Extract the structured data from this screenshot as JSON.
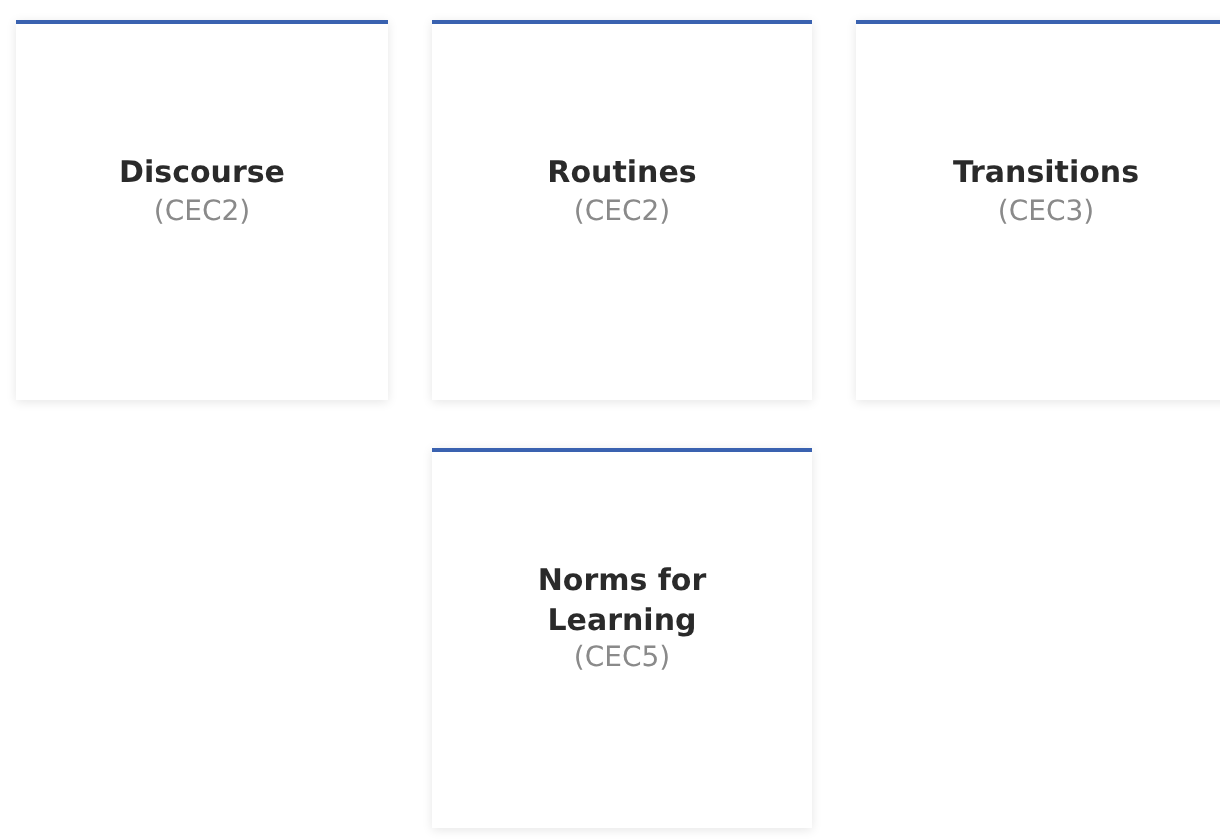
{
  "cards": [
    {
      "title": "Discourse",
      "code": "(CEC2)"
    },
    {
      "title": "Routines",
      "code": "(CEC2)"
    },
    {
      "title": "Transitions",
      "code": "(CEC3)"
    },
    {
      "title": "Norms for Learning",
      "code": "(CEC5)"
    }
  ]
}
